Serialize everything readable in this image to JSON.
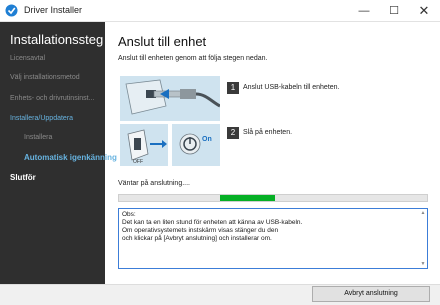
{
  "window": {
    "title": "Driver Installer",
    "minimize": "—",
    "maximize": "☐",
    "close": "✕"
  },
  "sidebar": {
    "title": "Installationssteg",
    "steps": [
      {
        "label": "Licensavtal",
        "state": "dim"
      },
      {
        "label": "Välj installationsmetod",
        "state": "dim"
      },
      {
        "label": "Enhets- och drivrutinsinst...",
        "state": "dim"
      },
      {
        "label": "Installera/Uppdatera",
        "state": "done"
      },
      {
        "label": "Installera",
        "state": "dim"
      },
      {
        "label": "Automatisk igenkänning",
        "state": "active"
      },
      {
        "label": "Slutför",
        "state": "current"
      }
    ]
  },
  "main": {
    "title": "Anslut till enhet",
    "instruction": "Anslut till enheten genom att följa stegen nedan.",
    "steps": [
      {
        "number": "1",
        "label": "Anslut USB-kabeln till enheten."
      },
      {
        "number": "2",
        "label": "Slå på enheten."
      }
    ],
    "illustration": {
      "off_label": "OFF",
      "on_label": "On"
    },
    "waiting": "Väntar på anslutning....",
    "progress_fraction": 0.18,
    "note_lines": [
      "Obs:",
      "Det kan ta en liten stund för enheten att känna av USB-kabeln.",
      "Om operativsystemets instskärm visas stänger du den",
      "och klickar på [Avbryt anslutning] och installerar om."
    ]
  },
  "footer": {
    "cancel_label": "Avbryt anslutning"
  },
  "colors": {
    "sidebar_bg": "#2f2f2f",
    "accent": "#67b3e0",
    "progress": "#06b025"
  }
}
